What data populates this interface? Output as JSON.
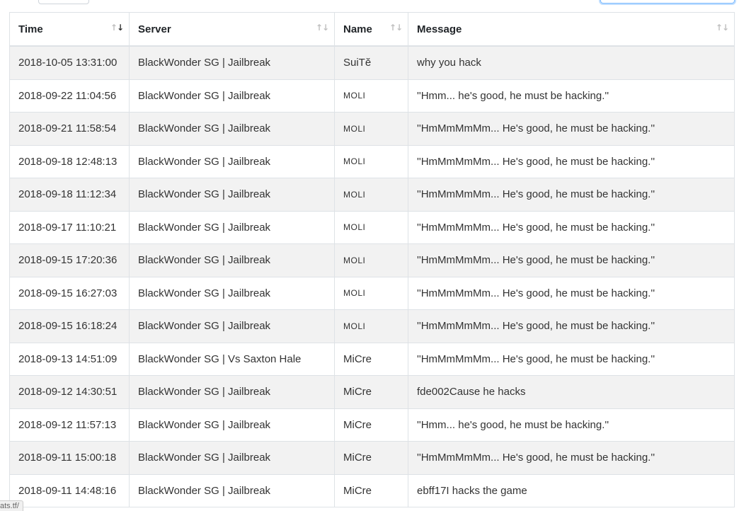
{
  "table": {
    "columns": [
      "Time",
      "Server",
      "Name",
      "Message"
    ],
    "rows": [
      {
        "time": "2018-10-05 13:31:00",
        "server": "BlackWonder SG | Jailbreak",
        "name": "SuiTĕ",
        "message": "why you hack"
      },
      {
        "time": "2018-09-22 11:04:56",
        "server": "BlackWonder SG | Jailbreak",
        "name": "MOLI",
        "message": "''Hmm... he's good, he must be hacking.''"
      },
      {
        "time": "2018-09-21 11:58:54",
        "server": "BlackWonder SG | Jailbreak",
        "name": "MOLI",
        "message": "''HmMmMmMm... He's good, he must be hacking.''"
      },
      {
        "time": "2018-09-18 12:48:13",
        "server": "BlackWonder SG | Jailbreak",
        "name": "MOLI",
        "message": "''HmMmMmMm... He's good, he must be hacking.''"
      },
      {
        "time": "2018-09-18 11:12:34",
        "server": "BlackWonder SG | Jailbreak",
        "name": "MOLI",
        "message": "''HmMmMmMm... He's good, he must be hacking.''"
      },
      {
        "time": "2018-09-17 11:10:21",
        "server": "BlackWonder SG | Jailbreak",
        "name": "MOLI",
        "message": "''HmMmMmMm... He's good, he must be hacking.''"
      },
      {
        "time": "2018-09-15 17:20:36",
        "server": "BlackWonder SG | Jailbreak",
        "name": "MOLI",
        "message": "''HmMmMmMm... He's good, he must be hacking.''"
      },
      {
        "time": "2018-09-15 16:27:03",
        "server": "BlackWonder SG | Jailbreak",
        "name": "MOLI",
        "message": "''HmMmMmMm... He's good, he must be hacking.''"
      },
      {
        "time": "2018-09-15 16:18:24",
        "server": "BlackWonder SG | Jailbreak",
        "name": "MOLI",
        "message": "''HmMmMmMm... He's good, he must be hacking.''"
      },
      {
        "time": "2018-09-13 14:51:09",
        "server": "BlackWonder SG | Vs Saxton Hale",
        "name": "MiCre",
        "message": "''HmMmMmMm... He's good, he must be hacking.''"
      },
      {
        "time": "2018-09-12 14:30:51",
        "server": "BlackWonder SG | Jailbreak",
        "name": "MiCre",
        "message": "fde002Cause he hacks"
      },
      {
        "time": "2018-09-12 11:57:13",
        "server": "BlackWonder SG | Jailbreak",
        "name": "MiCre",
        "message": "''Hmm... he's good, he must be hacking.''"
      },
      {
        "time": "2018-09-11 15:00:18",
        "server": "BlackWonder SG | Jailbreak",
        "name": "MiCre",
        "message": "''HmMmMmMm... He's good, he must be hacking.''"
      },
      {
        "time": "2018-09-11 14:48:16",
        "server": "BlackWonder SG | Jailbreak",
        "name": "MiCre",
        "message": "ebff17I hacks the game"
      }
    ]
  },
  "icons": {
    "sort_neutral": "sort-both-icon",
    "sort_active": "sort-desc-icon"
  },
  "status_bar": {
    "url_fragment": "ats.tf/"
  }
}
